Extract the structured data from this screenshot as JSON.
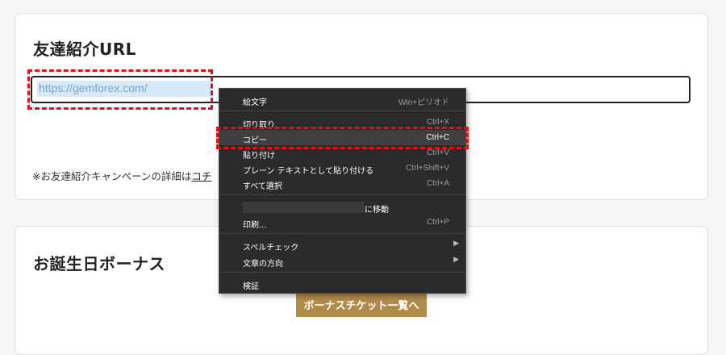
{
  "referral": {
    "title": "友達紹介URL",
    "url_value": "https://gemforex.com/",
    "note_text": "※お友達紹介キャンペーンの詳細は",
    "note_link": "コチ"
  },
  "birthday": {
    "title": "お誕生日ボーナス",
    "button_label": "ボーナスチケット一覧へ"
  },
  "colors": {
    "highlight": "#e0111a",
    "button": "#b08a49",
    "menu_bg": "#2b2b2b"
  },
  "context_menu": {
    "emoji": {
      "label": "絵文字",
      "shortcut": "Win+ピリオド"
    },
    "cut": {
      "label": "切り取り",
      "shortcut": "Ctrl+X"
    },
    "copy": {
      "label": "コピー",
      "shortcut": "Ctrl+C"
    },
    "paste": {
      "label": "貼り付け",
      "shortcut": "Ctrl+V"
    },
    "paste_plain": {
      "label": "プレーン テキストとして貼り付ける",
      "shortcut": "Ctrl+Shift+V"
    },
    "select_all": {
      "label": "すべて選択",
      "shortcut": "Ctrl+A"
    },
    "go_to": {
      "label": "に移動"
    },
    "print": {
      "label": "印刷...",
      "shortcut": "Ctrl+P"
    },
    "spellcheck": {
      "label": "スペルチェック",
      "arrow": "▶"
    },
    "text_direction": {
      "label": "文章の方向",
      "arrow": "▶"
    },
    "inspect": {
      "label": "検証"
    }
  }
}
